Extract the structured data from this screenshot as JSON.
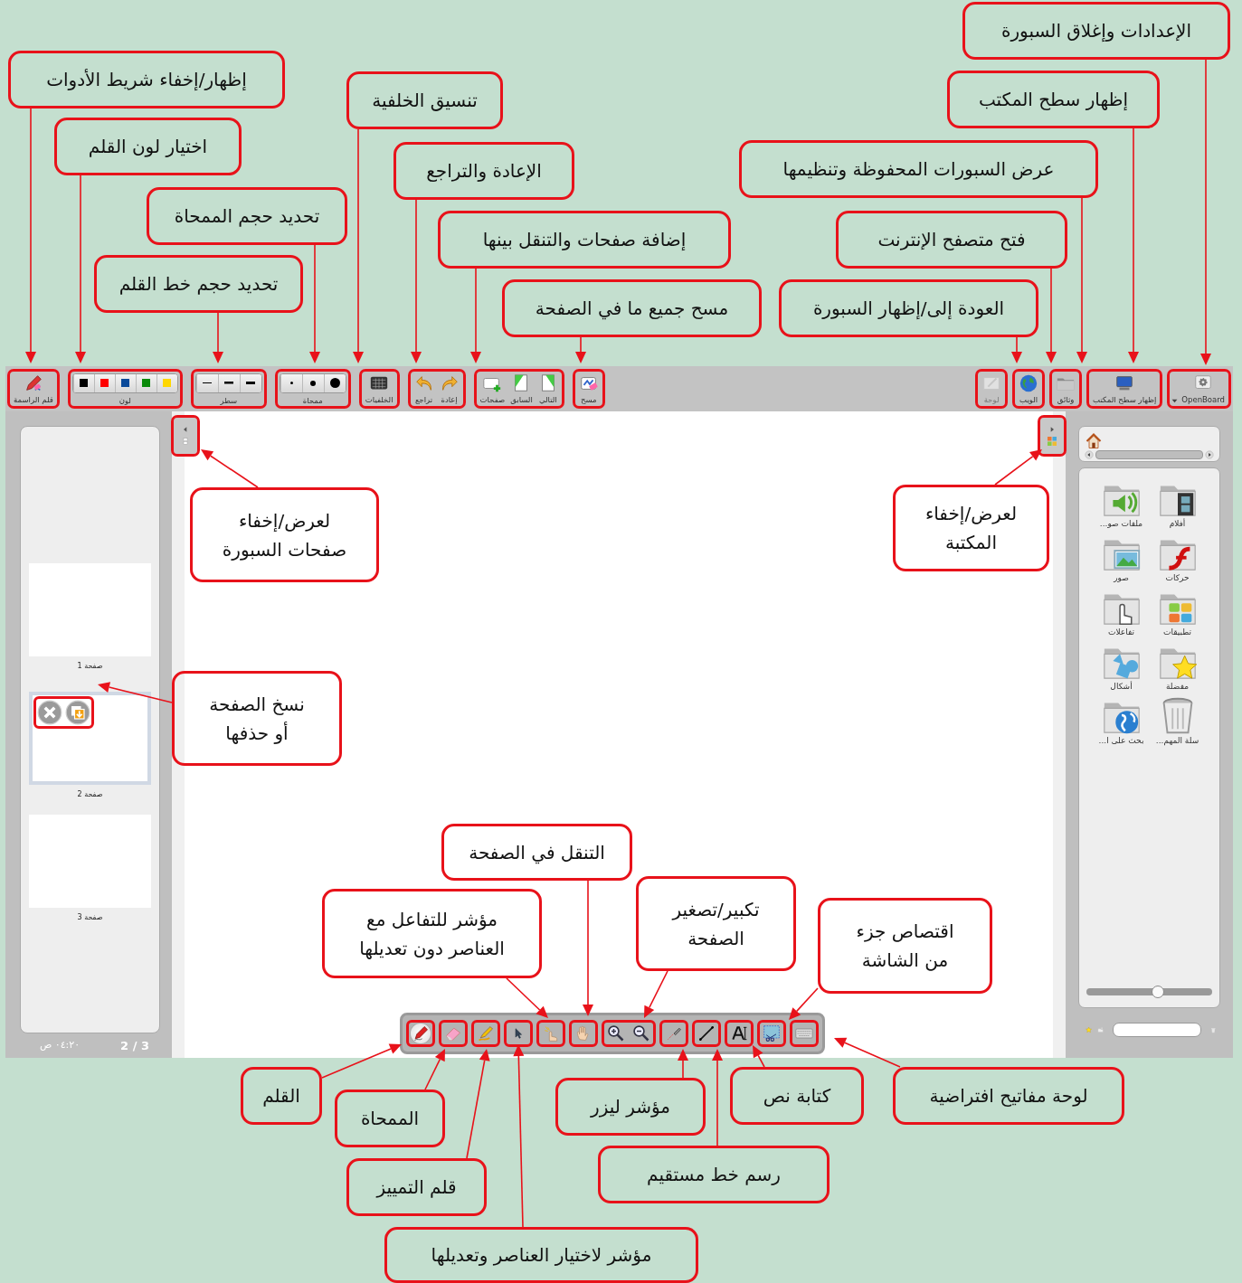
{
  "top_toolbar": {
    "right_items": [
      {
        "kind": "menu",
        "label": "OpenBoard",
        "disabled": false
      },
      {
        "kind": "desktop",
        "label": "إظهار سطح المكتب",
        "disabled": false
      },
      {
        "kind": "documents",
        "label": "وثائق",
        "disabled": false
      },
      {
        "kind": "web",
        "label": "الويب",
        "disabled": false
      },
      {
        "kind": "board",
        "label": "لوحة",
        "disabled": true
      }
    ],
    "left_groups": [
      {
        "items": [
          {
            "kind": "clear",
            "label": "مسح"
          }
        ]
      },
      {
        "items": [
          {
            "kind": "next",
            "label": "التالي"
          },
          {
            "kind": "previous",
            "label": "السابق"
          },
          {
            "kind": "pages",
            "label": "صفحات"
          }
        ]
      },
      {
        "items": [
          {
            "kind": "redo",
            "label": "إعادة"
          },
          {
            "kind": "undo",
            "label": "تراجع"
          }
        ]
      },
      {
        "items": [
          {
            "kind": "backgrounds",
            "label": "الخلفيات"
          }
        ]
      },
      {
        "items": [
          {
            "kind": "erasers",
            "label": "ممحاة"
          }
        ]
      },
      {
        "items": [
          {
            "kind": "widths",
            "label": "سطر"
          }
        ]
      },
      {
        "items": [
          {
            "kind": "colors",
            "label": "لون",
            "colors": [
              {
                "color": "#000000"
              },
              {
                "color": "#ff0000"
              },
              {
                "color": "#0a4a9a"
              },
              {
                "color": "#0a8a0a"
              },
              {
                "color": "#ffd700"
              }
            ]
          }
        ]
      },
      {
        "items": [
          {
            "kind": "pen",
            "label": "قلم الراسمة"
          }
        ]
      }
    ]
  },
  "pages_panel": {
    "pages": [
      {
        "label": "صفحة 1",
        "selected": false
      },
      {
        "label": "صفحة 2",
        "selected": true
      },
      {
        "label": "صفحة 3",
        "selected": false
      }
    ],
    "clock": "٠٤:٢٠ ص",
    "page_count": "2 / 3"
  },
  "library": {
    "items": [
      {
        "kind": "movies",
        "label": "أفلام"
      },
      {
        "kind": "audio",
        "label": "ملفات صو..."
      },
      {
        "kind": "animations",
        "label": "حركات"
      },
      {
        "kind": "pictures",
        "label": "صور"
      },
      {
        "kind": "apps",
        "label": "تطبيقات"
      },
      {
        "kind": "interactives",
        "label": "تفاعلات"
      },
      {
        "kind": "favorites",
        "label": "مفضلة"
      },
      {
        "kind": "shapes",
        "label": "أشكال"
      },
      {
        "kind": "trash",
        "label": "سلة المهم..."
      },
      {
        "kind": "search",
        "label": "بحث على ا..."
      }
    ],
    "zoom": {
      "level": 0.57
    }
  },
  "tools": {
    "groups": [
      {
        "items": [
          {
            "kind": "pen",
            "selected": true
          }
        ]
      },
      {
        "items": [
          {
            "kind": "eraser",
            "selected": false
          }
        ]
      },
      {
        "items": [
          {
            "kind": "marker",
            "selected": false
          }
        ]
      },
      {
        "items": [
          {
            "kind": "selector",
            "selected": false
          }
        ]
      },
      {
        "items": [
          {
            "kind": "interact",
            "selected": false
          }
        ]
      },
      {
        "items": [
          {
            "kind": "hand",
            "selected": false
          }
        ]
      },
      {
        "items": [
          {
            "kind": "zoomin",
            "selected": false
          },
          {
            "kind": "zoomout",
            "selected": false
          }
        ]
      },
      {
        "items": [
          {
            "kind": "laser",
            "selected": false
          }
        ]
      },
      {
        "items": [
          {
            "kind": "line",
            "selected": false
          }
        ]
      },
      {
        "items": [
          {
            "kind": "text",
            "selected": false
          }
        ]
      },
      {
        "items": [
          {
            "kind": "capture",
            "selected": false
          }
        ]
      },
      {
        "items": [
          {
            "kind": "keyboard",
            "selected": false
          }
        ]
      }
    ]
  },
  "callouts": [
    {
      "text": "الإعدادات وإغلاق السبورة"
    },
    {
      "text": "إظهار سطح المكتب"
    },
    {
      "text": "عرض السبورات المحفوظة وتنظيمها"
    },
    {
      "text": "فتح متصفح الإنترنت"
    },
    {
      "text": "العودة إلى/إظهار السبورة"
    },
    {
      "text": "إظهار/إخفاء شريط الأدوات"
    },
    {
      "text": "اختيار لون القلم"
    },
    {
      "text": "تحديد حجم الممحاة"
    },
    {
      "text": "تحديد حجم خط القلم"
    },
    {
      "text": "تنسيق الخلفية"
    },
    {
      "text": "الإعادة والتراجع"
    },
    {
      "text": "إضافة صفحات والتنقل بينها"
    },
    {
      "text": "مسح جميع ما في الصفحة"
    },
    {
      "text": "لعرض/إخفاء المكتبة"
    },
    {
      "text": "لعرض/إخفاء صفحات السبورة"
    },
    {
      "text": "نسخ الصفحة أو حذفها"
    },
    {
      "text": "التنقل في الصفحة"
    },
    {
      "text": "مؤشر للتفاعل مع العناصر دون تعديلها"
    },
    {
      "text": "تكبير/تصغير الصفحة"
    },
    {
      "text": "اقتصاص جزء من الشاشة"
    },
    {
      "text": "لوحة مفاتيح افتراضية"
    },
    {
      "text": "كتابة نص"
    },
    {
      "text": "القلم"
    },
    {
      "text": "مؤشر ليزر"
    },
    {
      "text": "الممحاة"
    },
    {
      "text": "رسم خط مستقيم"
    },
    {
      "text": "قلم التمييز"
    },
    {
      "text": "مؤشر لاختيار العناصر وتعديلها"
    }
  ]
}
